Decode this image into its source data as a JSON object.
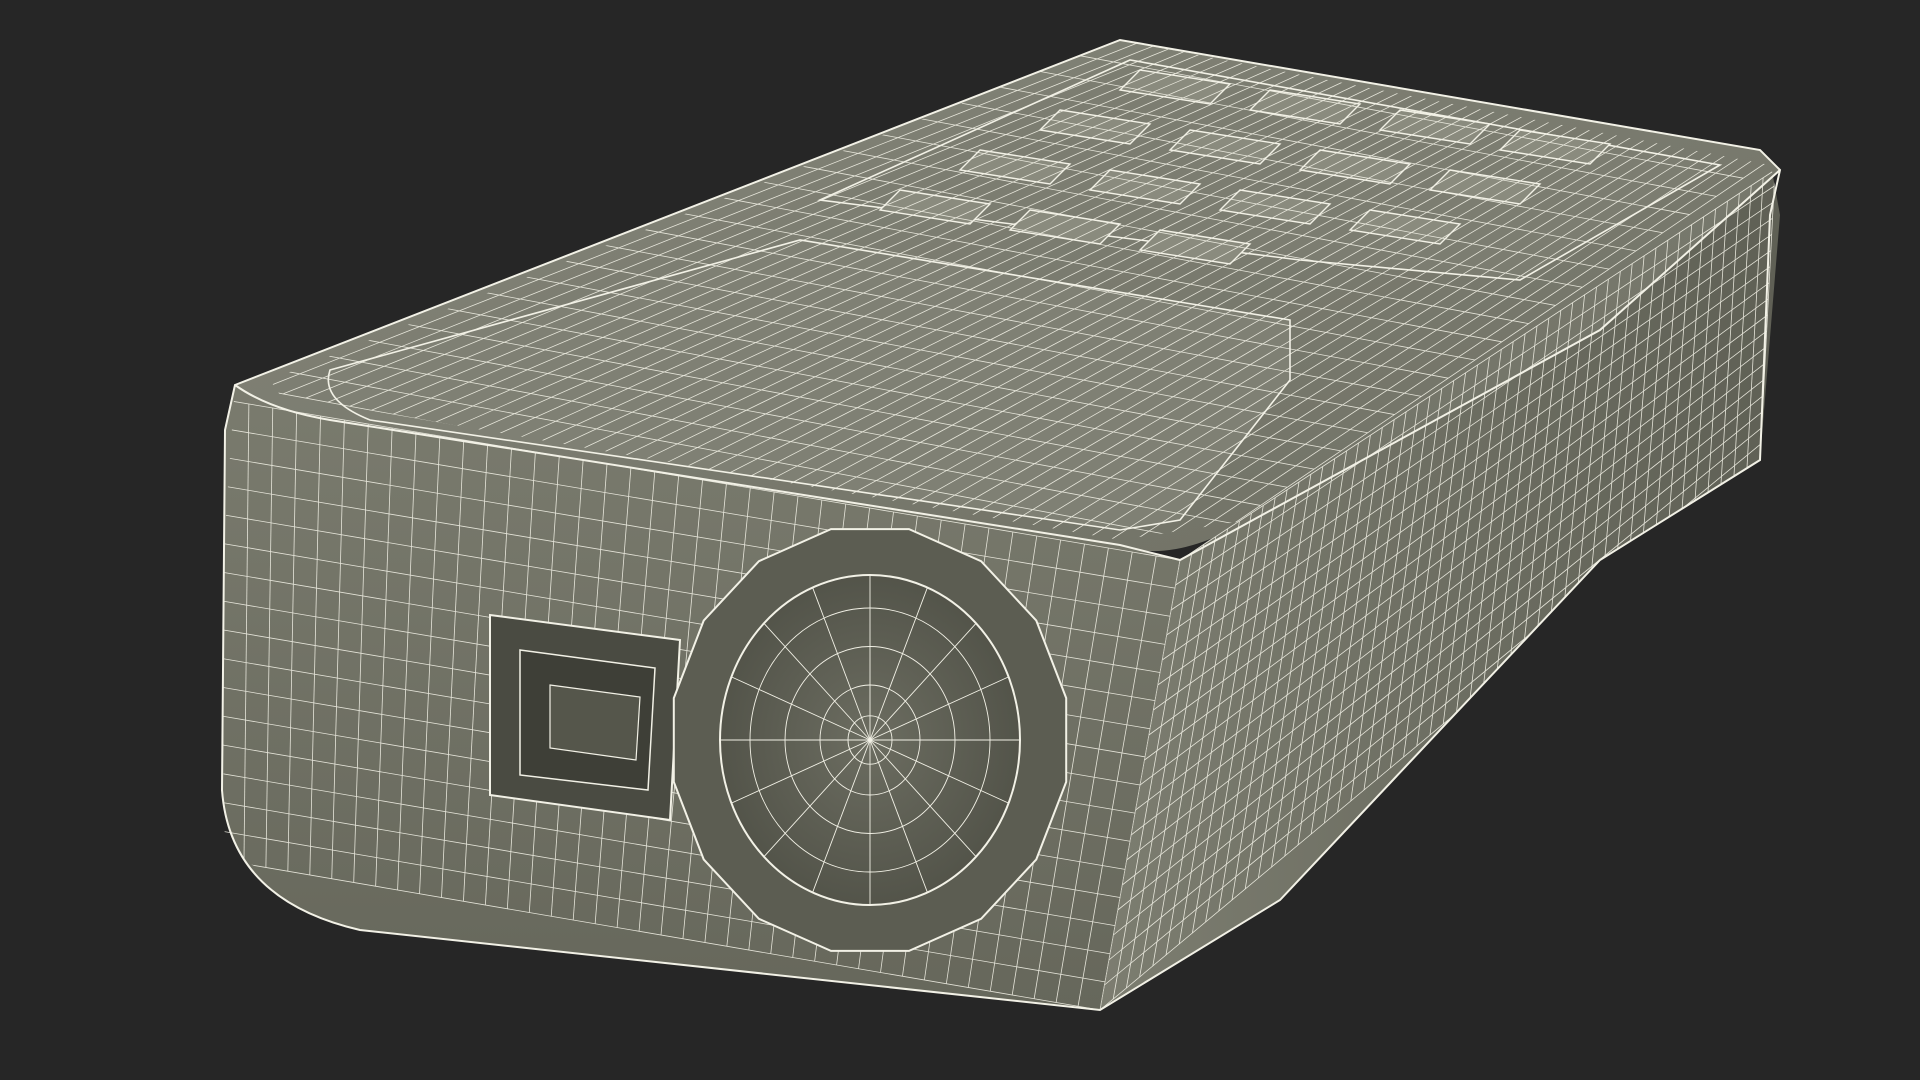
{
  "scene": {
    "subject": "laser-distance-meter-wireframe",
    "colors": {
      "background": "#262626",
      "body_light": "#8a8b7d",
      "body_mid": "#76776a",
      "body_dark": "#55564b",
      "wire": "#f2f1e6"
    }
  }
}
